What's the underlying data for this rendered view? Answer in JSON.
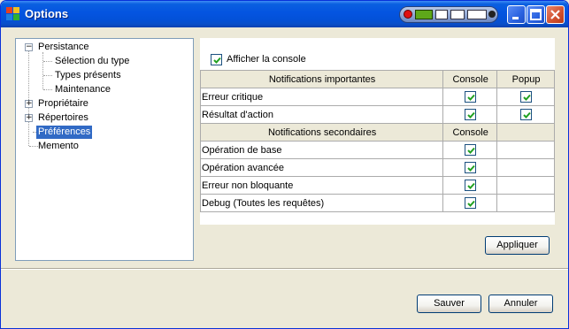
{
  "window": {
    "title": "Options"
  },
  "tree": {
    "items": [
      {
        "label": "Persistance",
        "expander": "−"
      },
      {
        "label": "Sélection du type"
      },
      {
        "label": "Types présents"
      },
      {
        "label": "Maintenance"
      },
      {
        "label": "Propriétaire",
        "expander": "+"
      },
      {
        "label": "Répertoires",
        "expander": "+"
      },
      {
        "label": "Préférences"
      },
      {
        "label": "Memento"
      }
    ],
    "selected": "Préférences"
  },
  "panel": {
    "console_checkbox": {
      "label": "Afficher la console",
      "checked": true
    },
    "important": {
      "header": "Notifications importantes",
      "col_console": "Console",
      "col_popup": "Popup",
      "rows": [
        {
          "name": "Erreur critique",
          "console": true,
          "popup": true
        },
        {
          "name": "Résultat d'action",
          "console": true,
          "popup": true
        }
      ]
    },
    "secondary": {
      "header": "Notifications secondaires",
      "col_console": "Console",
      "rows": [
        {
          "name": "Opération de base",
          "console": true
        },
        {
          "name": "Opération avancée",
          "console": true
        },
        {
          "name": "Erreur non bloquante",
          "console": true
        },
        {
          "name": "Debug (Toutes les requêtes)",
          "console": true
        }
      ]
    }
  },
  "buttons": {
    "apply": "Appliquer",
    "save": "Sauver",
    "cancel": "Annuler"
  },
  "colors": {
    "selection": "#316ac5",
    "check": "#21a121",
    "titlebar": "#0454e0"
  }
}
